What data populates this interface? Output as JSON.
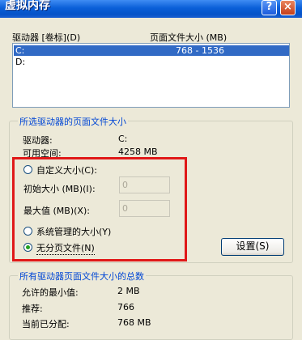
{
  "window": {
    "title": "虚拟内存",
    "help_icon": "?",
    "close_icon": "×"
  },
  "drive_list": {
    "col_drive": "驱动器 [卷标](D)",
    "col_pagefile": "页面文件大小 (MB)",
    "rows": [
      {
        "drive": "C:",
        "size": "768 - 1536",
        "selected": true
      },
      {
        "drive": "D:",
        "size": "",
        "selected": false
      }
    ]
  },
  "selected_group": {
    "legend": "所选驱动器的页面文件大小",
    "drive_label": "驱动器:",
    "drive_value": "C:",
    "space_label": "可用空间:",
    "space_value": "4258 MB",
    "custom_size": "自定义大小(C):",
    "initial_label": "初始大小 (MB)(I):",
    "initial_value": "0",
    "max_label": "最大值 (MB)(X):",
    "max_value": "0",
    "system_managed": "系统管理的大小(Y)",
    "no_pagefile": "无分页文件(N)",
    "selected_option": "no_pagefile",
    "set_button": "设置(S)"
  },
  "total_group": {
    "legend": "所有驱动器页面文件大小的总数",
    "min_label": "允许的最小值:",
    "min_value": "2 MB",
    "recommended_label": "推荐:",
    "recommended_value": "766",
    "current_label": "当前已分配:",
    "current_value": "768 MB"
  }
}
